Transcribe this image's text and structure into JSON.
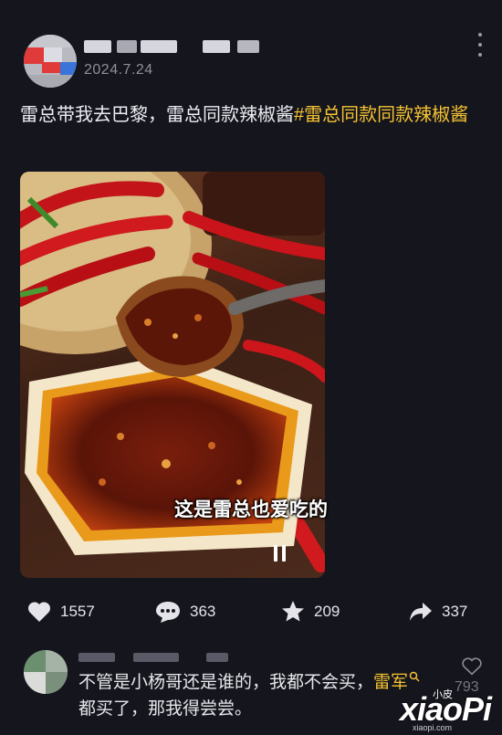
{
  "post": {
    "date": "2024.7.24",
    "caption": "雷总带我去巴黎，雷总同款辣椒酱",
    "hashtag": "#雷总同款同款辣椒酱"
  },
  "media": {
    "subtitle": "这是雷总也爱吃的"
  },
  "actions": {
    "likes": "1557",
    "comments": "363",
    "favorites": "209",
    "shares": "337"
  },
  "comment": {
    "text_before": "不管是小杨哥还是谁的，我都不会买，",
    "mention": "雷军",
    "text_after": "都买了，那我得尝尝。",
    "like_count": "793"
  },
  "watermark": {
    "logo": "xiaoPi",
    "small": "小皮",
    "url": "xiaopi.com"
  },
  "colors": {
    "background": "#15151d",
    "hashtag": "#f5c332"
  }
}
